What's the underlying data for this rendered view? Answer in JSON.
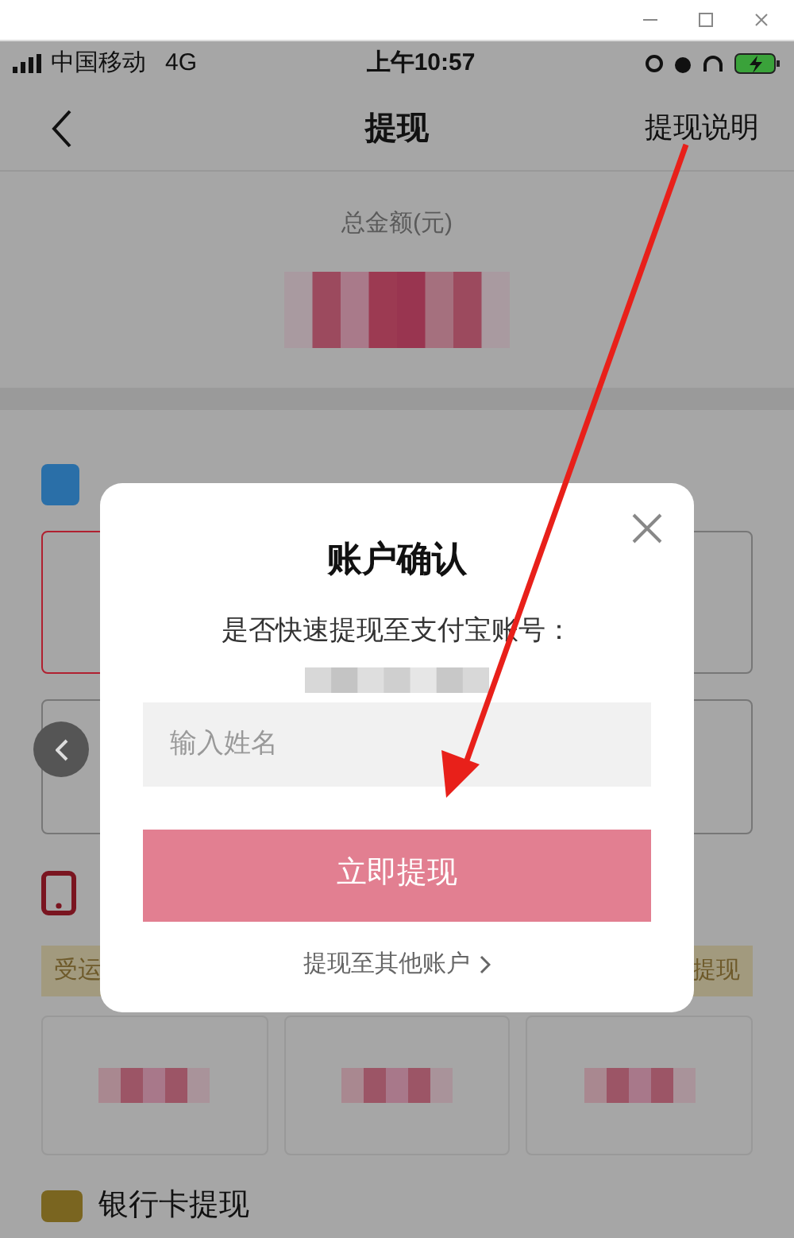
{
  "status_bar": {
    "carrier": "中国移动",
    "network": "4G",
    "time": "上午10:57"
  },
  "nav": {
    "title": "提现",
    "action": "提现说明"
  },
  "summary": {
    "label": "总金额(元)"
  },
  "sections": [
    {
      "kind": "alipay"
    },
    {
      "kind": "phone",
      "banner_left": "受运",
      "banner_right": "提现"
    },
    {
      "kind": "bank",
      "title": "银行卡提现"
    }
  ],
  "dialog": {
    "title": "账户确认",
    "message": "是否快速提现至支付宝账号：",
    "name_field": {
      "placeholder": "输入姓名"
    },
    "submit": {
      "label": "立即提现",
      "disabled": true
    },
    "other_link": "提现至其他账户"
  }
}
